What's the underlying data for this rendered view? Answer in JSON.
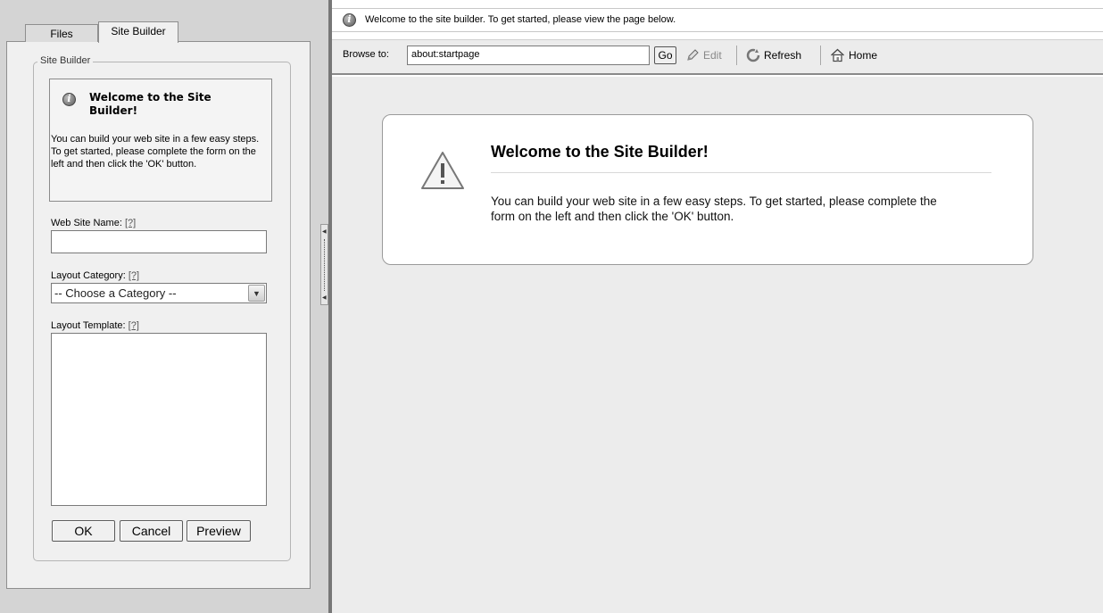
{
  "left_panel": {
    "tabs": [
      {
        "label": "Files"
      },
      {
        "label": "Site Builder"
      }
    ],
    "fieldset_legend": "Site Builder",
    "welcome": {
      "title": "Welcome to the Site Builder!",
      "text": "You can build your web site in a few easy steps. To get started, please complete the form on the left and then click the 'OK' button."
    },
    "form": {
      "name_label": "Web Site Name:",
      "name_value": "",
      "category_label": "Layout Category:",
      "category_selected": "-- Choose a Category --",
      "template_label": "Layout Template:",
      "help_text": "[?]"
    },
    "buttons": {
      "ok": "OK",
      "cancel": "Cancel",
      "preview": "Preview"
    }
  },
  "right_panel": {
    "info_message": "Welcome to the site builder. To get started, please view the page below.",
    "toolbar": {
      "browse_label": "Browse to:",
      "browse_value": "about:startpage",
      "go_label": "Go",
      "edit_label": "Edit",
      "refresh_label": "Refresh",
      "home_label": "Home"
    },
    "card": {
      "title": "Welcome to the Site Builder!",
      "text": "You can build your web site in a few easy steps. To get started, please complete the form on the left and then click the 'OK' button."
    }
  },
  "icons": {
    "info": "info-icon",
    "warning": "warning-icon",
    "edit": "pencil-icon",
    "refresh": "refresh-icon",
    "home": "home-icon",
    "dropdown": "chevron-down-icon"
  }
}
